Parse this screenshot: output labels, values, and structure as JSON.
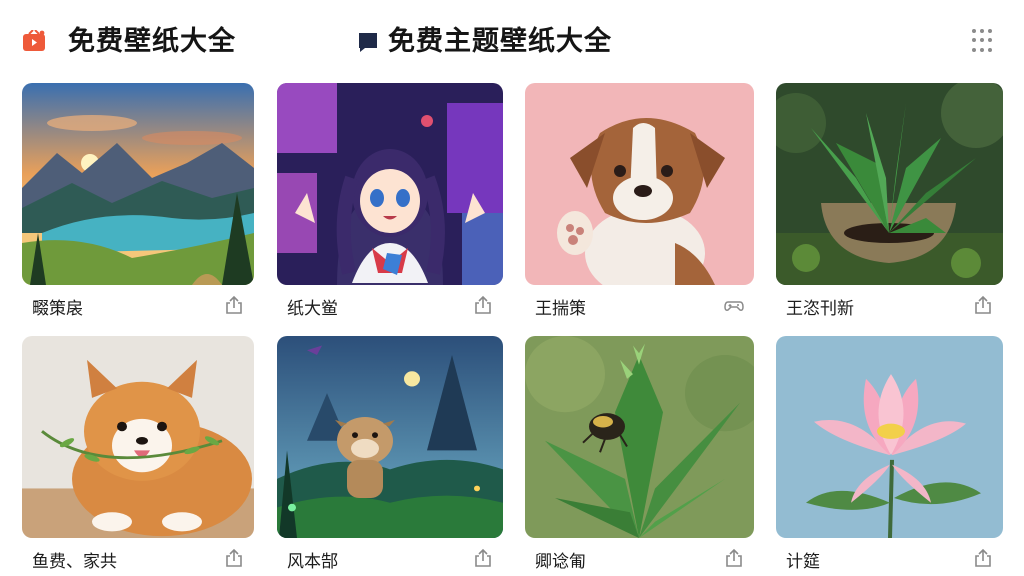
{
  "header": {
    "tabs": [
      {
        "label": "免费壁纸大全",
        "icon": "video-card-icon",
        "icon_color": "#ee5a3a"
      },
      {
        "label": "免费主题壁纸大全",
        "icon": "chat-bubble-icon",
        "icon_color": "#1f2a48"
      }
    ],
    "menu_icon": "grid-dots-icon"
  },
  "cards": [
    {
      "title": "畷策扆",
      "image": "mountain-lake-sunset",
      "icon": "share-icon"
    },
    {
      "title": "纸大鲎",
      "image": "anime-girl-waving",
      "icon": "share-icon"
    },
    {
      "title": "王揣策",
      "image": "puppy-waving-pink",
      "icon": "gamepad-icon"
    },
    {
      "title": "王恣刊新",
      "image": "succulent-plant",
      "icon": "share-icon"
    },
    {
      "title": "鱼费、家共",
      "image": "corgi-puppy-with-leaves",
      "icon": "share-icon"
    },
    {
      "title": "风本郜",
      "image": "cartoon-dog-fantasy-forest",
      "icon": "share-icon"
    },
    {
      "title": "卿谂匍",
      "image": "beetle-on-plant",
      "icon": "share-icon"
    },
    {
      "title": "计筵",
      "image": "pink-lotus-flower",
      "icon": "share-icon"
    }
  ]
}
